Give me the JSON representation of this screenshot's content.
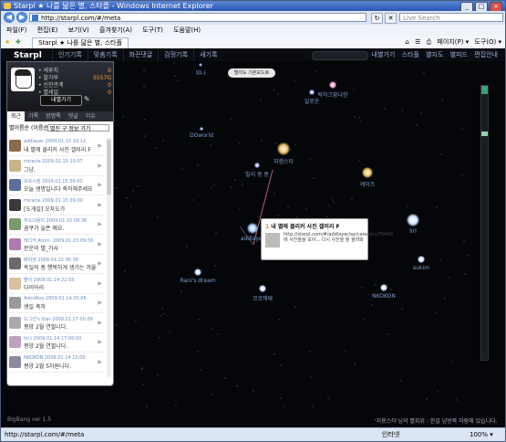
{
  "window": {
    "title": "Starpl ★ 나를 닮은 별, 스타플 - Windows Internet Explorer"
  },
  "browser": {
    "url": "http://starpl.com/#/meta",
    "search_placeholder": "Live Search",
    "menu": [
      "파일(F)",
      "편집(E)",
      "보기(V)",
      "즐겨찾기(A)",
      "도구(T)",
      "도움말(H)"
    ],
    "tab_title": "Starpl ★ 나를 닮은 별, 스타플",
    "tools": [
      "페이지(P) ▾",
      "도구(O) ▾"
    ],
    "status": "http://starpl.com/#/meta",
    "zone": "인터넷",
    "zoom": "100% ▾"
  },
  "site": {
    "logo": "Starpl",
    "nav": [
      "인기기록",
      "맞춤기록",
      "화끈댓글",
      "감정기록",
      "새기록"
    ],
    "links": [
      "내별가기",
      "스타플",
      "별지도",
      "별피드",
      "편집안내"
    ],
    "version": "BigBang ver 1.5",
    "bottom_note": "'지용스타'님의 별회위 : 한걸 넘방북 하람에 있습니다."
  },
  "profile": {
    "stats": [
      {
        "k": "• 세루치",
        "v": "0"
      },
      {
        "k": "• 발가루",
        "v": "5557G"
      },
      {
        "k": "• 신한관계",
        "v": "0"
      },
      {
        "k": "• 별세일",
        "v": "0"
      }
    ],
    "my_star": "내별가기"
  },
  "panel": {
    "tabs": [
      "최근",
      "기록",
      "방명록",
      "댓글",
      "이슈"
    ],
    "filter_label": "별이름순 (이름순)",
    "filter_value": "별진 구 정보 가기",
    "items": [
      {
        "name": "addlayer 2009.01.15 10:12",
        "text": "내 별에 클리커 사진 갤러리 F",
        "color": "#8a6a4a"
      },
      {
        "name": "miracle 2009.01.15 10:07",
        "text": "그냥.",
        "color": "#c9b48a"
      },
      {
        "name": "모르시셈 2009.01.15 09:00",
        "text": "오늘 생명일니다 축하해주세요",
        "color": "#5a6f9a"
      },
      {
        "name": "miracle 2009.01.15 09:00",
        "text": "[도개길] 오자도가",
        "color": "#3a3a3a"
      },
      {
        "name": "무소녀용이 2009.01.15 09:38",
        "text": "꿈쿠가 슬픈 예요.",
        "color": "#7a9a6a"
      },
      {
        "name": "레디카 Atom. 2009.01.15 09:36",
        "text": "분운의 별_가사",
        "color": "#b07ab0"
      },
      {
        "name": "배리엠 2009.01.15 05:38",
        "text": "독일의 중 행복하게 생기는 겨울다",
        "color": "#6a6a6a"
      },
      {
        "name": "별이 2009.01.14 22:55",
        "text": "다이어리",
        "color": "#d8c0a0"
      },
      {
        "name": "AstroBoy 2009.01.14 20:06",
        "text": "생일 축하",
        "color": "#9a9a9a"
      },
      {
        "name": "드그선's Star 2009.01.17 00:00",
        "text": "평양 2월 연필니다.",
        "color": "#aaaaaa"
      },
      {
        "name": "hi나 2009.01.14 17:00:00",
        "text": "평양 2월 연필니다.",
        "color": "#c0a0c0"
      },
      {
        "name": "NKOKON 2009.01.14 10:00",
        "text": "평양 2월 5차원니다.",
        "color": "#8a8aa0"
      }
    ]
  },
  "map": {
    "badge": "별지도 기본모드로",
    "stars": [
      {
        "label": "위나",
        "color": "#5a7ab0",
        "size": 4
      },
      {
        "label": "DOworld",
        "color": "#7fa0e0",
        "size": 4
      },
      {
        "label": "지캠스타",
        "color": "#f0c060",
        "size": 14
      },
      {
        "label": "빌리 중 중",
        "color": "#aab0ff",
        "size": 6
      },
      {
        "label": "케이즈",
        "color": "#f0c060",
        "size": 12
      },
      {
        "label": "탁하크황나한",
        "color": "#ffa0d0",
        "size": 8
      },
      {
        "label": "일로운",
        "color": "#b0b0ff",
        "size": 6
      },
      {
        "label": "addlayer",
        "color": "#9fd0ff",
        "size": 12
      },
      {
        "label": "lirl",
        "color": "#cfe6ff",
        "size": 14
      },
      {
        "label": "Rani's dream",
        "color": "#bfe0ff",
        "size": 8
      },
      {
        "label": "코코해왜",
        "color": "#cfe6ff",
        "size": 8
      },
      {
        "label": "NKOKON",
        "color": "#cfe6ff",
        "size": 8
      },
      {
        "label": "sukim",
        "color": "#cfe6ff",
        "size": 8
      }
    ],
    "popup": {
      "num": "1",
      "title": "내 별에 클리커 사진 갤러리 F",
      "body": "http://starpl.com/#/addlayer/ay/category/79400에 사진들을 모아... 다시 사진을 들 올려봐"
    }
  }
}
